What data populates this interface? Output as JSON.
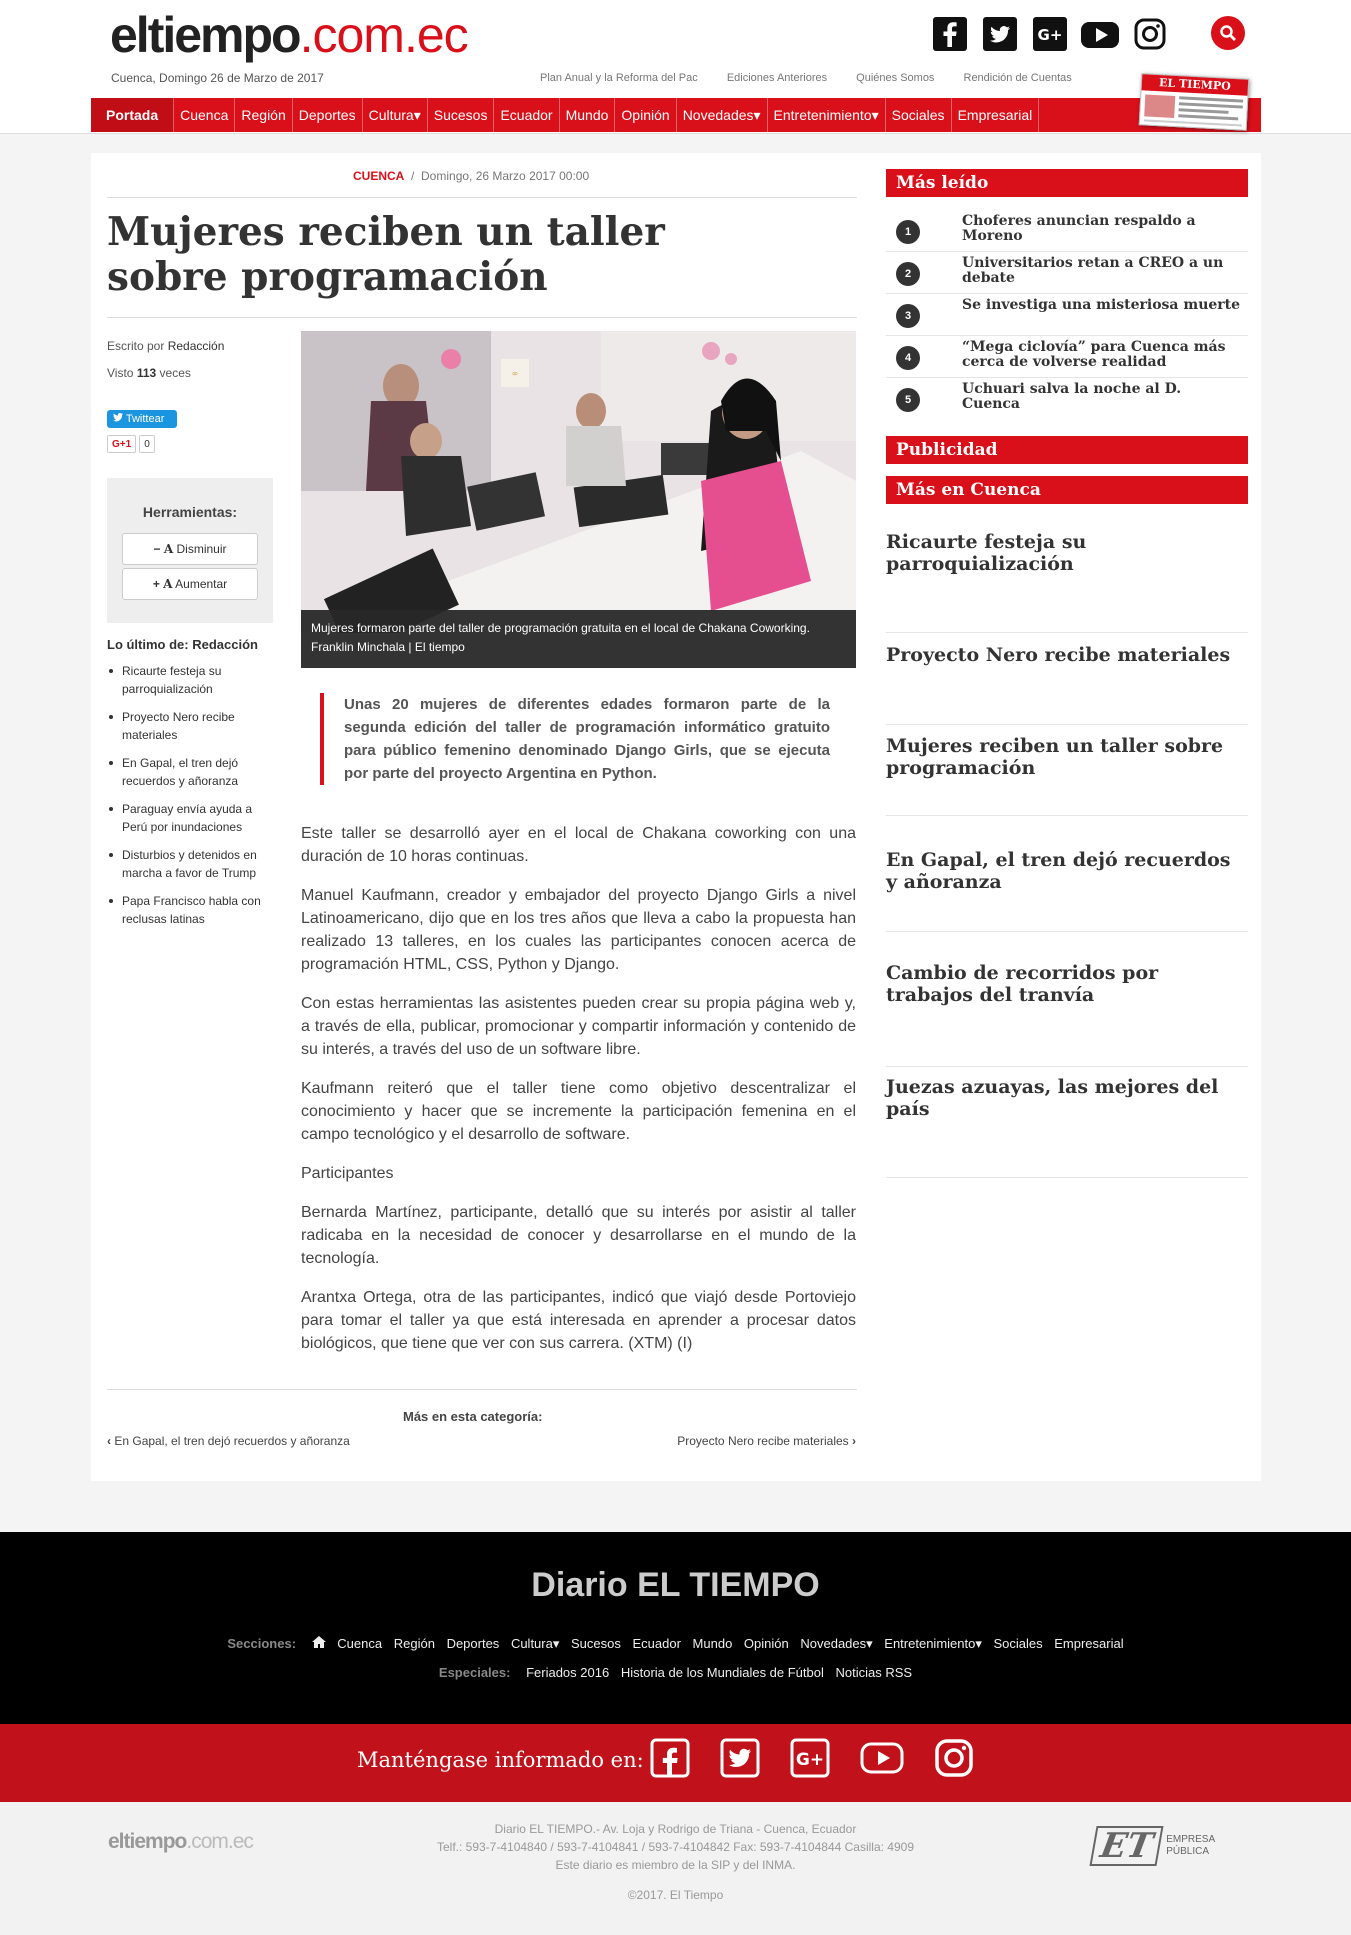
{
  "header": {
    "logo_main": "eltiempo",
    "logo_domain": ".com.ec",
    "date_line": "Cuenca, Domingo 26 de Marzo de 2017",
    "top_links": [
      "Plan Anual y la Reforma del Pac",
      "Ediciones Anteriores",
      "Quiénes Somos",
      "Rendición de Cuentas"
    ],
    "social_icons": [
      "facebook-icon",
      "twitter-icon",
      "google-plus-icon",
      "youtube-icon",
      "instagram-icon"
    ],
    "newspaper_label": "EL TIEMPO"
  },
  "nav": {
    "items": [
      {
        "label": "Portada",
        "active": true
      },
      {
        "label": "Cuenca"
      },
      {
        "label": "Región"
      },
      {
        "label": "Deportes"
      },
      {
        "label": "Cultura▾"
      },
      {
        "label": "Sucesos"
      },
      {
        "label": "Ecuador"
      },
      {
        "label": "Mundo"
      },
      {
        "label": "Opinión"
      },
      {
        "label": "Novedades▾"
      },
      {
        "label": "Entretenimiento▾"
      },
      {
        "label": "Sociales"
      },
      {
        "label": "Empresarial"
      }
    ]
  },
  "article": {
    "category": "CUENCA",
    "datetime": "Domingo, 26 Marzo 2017 00:00",
    "title": "Mujeres reciben un taller sobre programación",
    "author_label": "Escrito por",
    "author": "Redacción",
    "views_prefix": "Visto",
    "views": "113",
    "views_suffix": "veces",
    "tweet_label": "Twittear",
    "gplus_label": "G+1",
    "gplus_count": "0",
    "tools_title": "Herramientas:",
    "tool_decrease": "Disminuir",
    "tool_increase": "Aumentar",
    "latest_title": "Lo último de: Redacción",
    "latest": [
      "Ricaurte festeja su parroquialización",
      "Proyecto Nero recibe materiales",
      "En Gapal, el tren dejó recuerdos y añoranza",
      "Paraguay envía ayuda a Perú por inundaciones",
      "Disturbios y detenidos en marcha a favor de Trump",
      "Papa Francisco habla con reclusas latinas"
    ],
    "photo_caption": "Mujeres formaron parte del taller de programación gratuita en el local de Chakana Coworking. Franklin Minchala | El tiempo",
    "lead": "Unas 20 mujeres de diferentes edades formaron parte de la segunda edición del taller de programación informático gratuito para público femenino denominado Django Girls, que se ejecuta por parte del proyecto Argentina en Python.",
    "paragraphs": [
      "Este taller se desarrolló ayer en el local de Chakana coworking con una duración de 10 horas continuas.",
      "Manuel Kaufmann, creador y embajador del proyecto Django Girls a nivel Latinoamericano, dijo que en los tres años que lleva a cabo la propuesta han realizado 13 talleres, en los cuales las participantes conocen acerca de programación HTML, CSS, Python y Django.",
      "Con estas herramientas las asistentes pueden crear su propia página web y, a través de ella, publicar, promocionar y compartir información y contenido de su interés, a través del uso de un software libre.",
      "Kaufmann reiteró que el taller tiene como objetivo descentralizar el conocimiento y hacer que se incremente la participación femenina en el campo tecnológico y el desarrollo de software.",
      "Participantes",
      "Bernarda Martínez, participante, detalló que su interés por asistir al taller radicaba en la necesidad de conocer y desarrollarse en el mundo de la tecnología.",
      "Arantxa Ortega, otra de las participantes, indicó que viajó desde Portoviejo para tomar el taller ya que está interesada en aprender a procesar datos biológicos, que tiene que ver con sus carrera. (XTM) (I)"
    ],
    "more_in_category": "Más en esta categoría:",
    "prev_link": "En Gapal, el tren dejó recuerdos y añoranza",
    "next_link": "Proyecto Nero recibe materiales"
  },
  "sidebar": {
    "mas_leido_title": "Más leído",
    "mas_leido": [
      {
        "num": "1",
        "title": "Choferes anuncian respaldo a Moreno"
      },
      {
        "num": "2",
        "title": "Universitarios retan a CREO a un debate"
      },
      {
        "num": "3",
        "title": "Se investiga una misteriosa muerte"
      },
      {
        "num": "4",
        "title": "“Mega ciclovía” para Cuenca más cerca de volverse realidad"
      },
      {
        "num": "5",
        "title": "Uchuari salva la noche al D. Cuenca"
      }
    ],
    "publicidad_title": "Publicidad",
    "mas_en_cuenca_title": "Más en Cuenca",
    "mas_en_cuenca": [
      "Ricaurte festeja su parroquialización",
      "Proyecto Nero recibe materiales",
      "Mujeres reciben un taller sobre programación",
      "En Gapal, el tren dejó recuerdos y añoranza",
      "Cambio de recorridos por trabajos del tranvía",
      "Juezas azuayas, las mejores del país"
    ]
  },
  "footer": {
    "title": "Diario EL TIEMPO",
    "sections_label": "Secciones:",
    "sections": [
      "Cuenca",
      "Región",
      "Deportes",
      "Cultura▾",
      "Sucesos",
      "Ecuador",
      "Mundo",
      "Opinión",
      "Novedades▾",
      "Entretenimiento▾",
      "Sociales",
      "Empresarial"
    ],
    "specials_label": "Especiales:",
    "specials": [
      "Feriados 2016",
      "Historia de los Mundiales de Fútbol",
      "Noticias RSS"
    ],
    "stay_informed": "Manténgase informado en:",
    "address_lines": [
      "Diario EL TIEMPO.- Av. Loja y Rodrigo de Triana - Cuenca, Ecuador",
      "Telf.: 593-7-4104840 / 593-7-4104841 / 593-7-4104842 Fax: 593-7-4104844 Casilla: 4909",
      "Este diario es miembro de la SIP y del INMA."
    ],
    "copyright": "©2017. El Tiempo",
    "logo_main": "eltiempo",
    "logo_domain": ".com.ec",
    "et_logo": "ET",
    "et_caption_1": "EMPRESA",
    "et_caption_2": "PÚBLICA"
  },
  "colors": {
    "brand_red": "#d9101a",
    "footer_black": "#000000",
    "footer_red": "#c1121c"
  }
}
